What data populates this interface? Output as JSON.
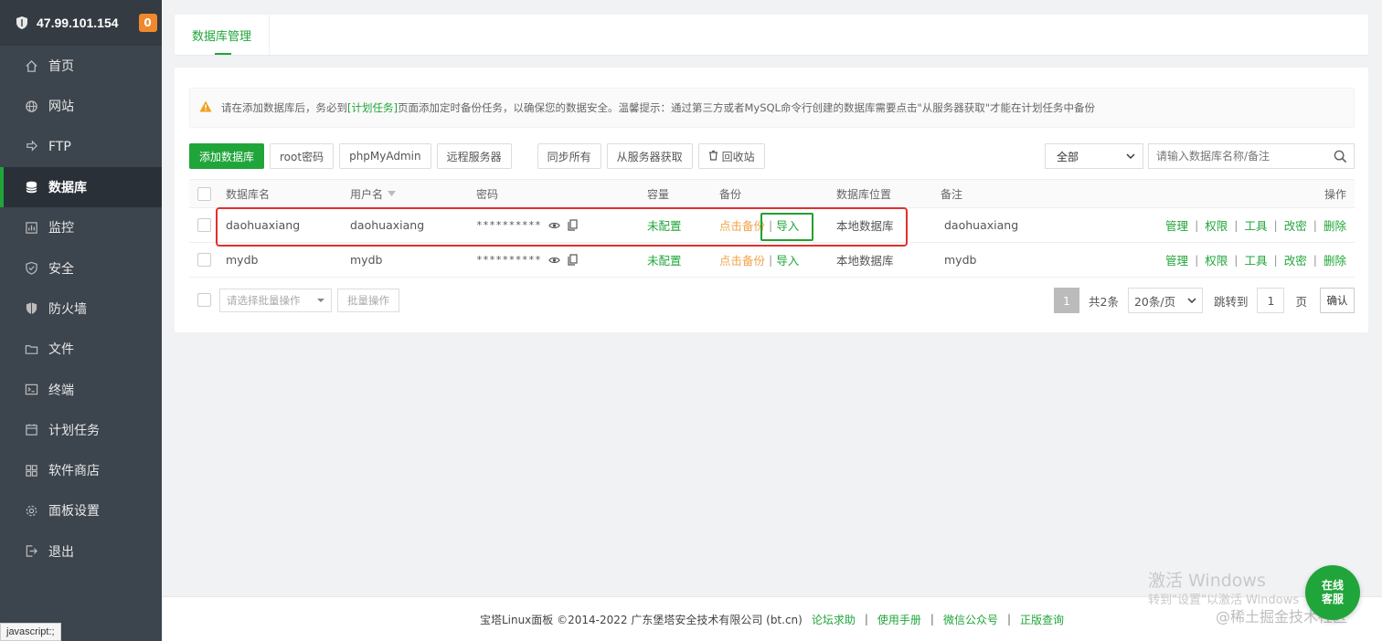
{
  "sidebar": {
    "server_ip": "47.99.101.154",
    "badge": "0",
    "items": [
      {
        "label": "首页",
        "icon": "home-icon"
      },
      {
        "label": "网站",
        "icon": "globe-icon"
      },
      {
        "label": "FTP",
        "icon": "ftp-icon"
      },
      {
        "label": "数据库",
        "icon": "database-icon",
        "active": true
      },
      {
        "label": "监控",
        "icon": "monitor-icon"
      },
      {
        "label": "安全",
        "icon": "shield-check-icon"
      },
      {
        "label": "防火墙",
        "icon": "firewall-icon"
      },
      {
        "label": "文件",
        "icon": "folder-icon"
      },
      {
        "label": "终端",
        "icon": "terminal-icon"
      },
      {
        "label": "计划任务",
        "icon": "calendar-icon"
      },
      {
        "label": "软件商店",
        "icon": "apps-icon"
      },
      {
        "label": "面板设置",
        "icon": "gear-icon"
      },
      {
        "label": "退出",
        "icon": "logout-icon"
      }
    ]
  },
  "tab": {
    "label": "数据库管理"
  },
  "notice": {
    "pre": "请在添加数据库后，务必到",
    "link": "[计划任务]",
    "post": "页面添加定时备份任务，以确保您的数据安全。温馨提示：通过第三方或者MySQL命令行创建的数据库需要点击\"从服务器获取\"才能在计划任务中备份"
  },
  "toolbar": {
    "add_db": "添加数据库",
    "root_pwd": "root密码",
    "phpmyadmin": "phpMyAdmin",
    "remote": "远程服务器",
    "sync_all": "同步所有",
    "fetch": "从服务器获取",
    "recycle": "回收站",
    "filter_value": "全部",
    "search_placeholder": "请输入数据库名称/备注"
  },
  "table": {
    "headers": {
      "name": "数据库名",
      "user": "用户名",
      "password": "密码",
      "capacity": "容量",
      "backup": "备份",
      "location": "数据库位置",
      "note": "备注",
      "ops": "操作"
    },
    "rows": [
      {
        "name": "daohuaxiang",
        "user": "daohuaxiang",
        "password": "**********",
        "capacity": "未配置",
        "backup": "点击备份",
        "import": "导入",
        "location": "本地数据库",
        "note": "daohuaxiang"
      },
      {
        "name": "mydb",
        "user": "mydb",
        "password": "**********",
        "capacity": "未配置",
        "backup": "点击备份",
        "import": "导入",
        "location": "本地数据库",
        "note": "mydb"
      }
    ],
    "ops": [
      "管理",
      "权限",
      "工具",
      "改密",
      "删除"
    ]
  },
  "batch": {
    "placeholder": "请选择批量操作",
    "button": "批量操作"
  },
  "pager": {
    "current": "1",
    "total": "共2条",
    "page_size": "20条/页",
    "jump_label": "跳转到",
    "jump_value": "1",
    "page_unit": "页",
    "confirm": "确认"
  },
  "footer": {
    "copyright": "宝塔Linux面板 ©2014-2022 广东堡塔安全技术有限公司 (bt.cn)",
    "links": [
      "论坛求助",
      "使用手册",
      "微信公众号",
      "正版查询"
    ]
  },
  "status_bar": "javascript:;",
  "chat": {
    "line1": "在线",
    "line2": "客服"
  },
  "watermark": {
    "line1": "激活 Windows",
    "line2": "转到\"设置\"以激活 Windows",
    "line3": "@稀土掘金技术社区"
  },
  "colors": {
    "accent": "#20a53a",
    "warning": "#f0a34a",
    "sidebar": "#3c444d",
    "annotation_red": "#e03030"
  }
}
